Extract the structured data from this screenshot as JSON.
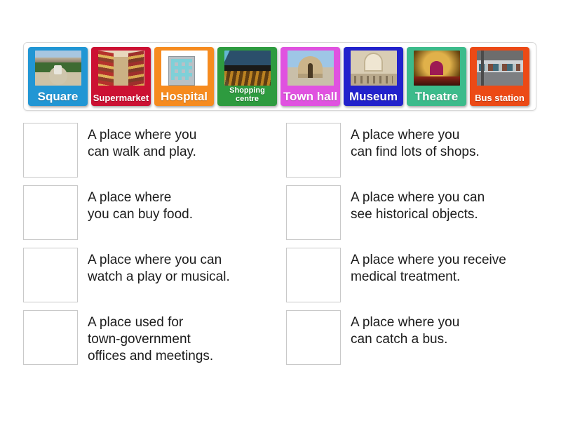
{
  "activity": {
    "type": "match-up",
    "tray_label": "Draggable word tiles"
  },
  "tiles": [
    {
      "label": "Square",
      "color": "#2196d4",
      "art": "art-square",
      "size": "size-lg"
    },
    {
      "label": "Supermarket",
      "color": "#cc1133",
      "art": "art-supermarket",
      "size": "size-md"
    },
    {
      "label": "Hospital",
      "color": "#f68b1f",
      "art": "art-hospital",
      "size": "size-lg"
    },
    {
      "label": "Shopping\ncentre",
      "color": "#2e9b3f",
      "art": "art-shopping",
      "size": "size-xs"
    },
    {
      "label": "Town hall",
      "color": "#e052e0",
      "art": "art-townhall",
      "size": "size-lg"
    },
    {
      "label": "Museum",
      "color": "#2222cc",
      "art": "art-museum",
      "size": "size-lg"
    },
    {
      "label": "Theatre",
      "color": "#3cbb8b",
      "art": "art-theatre",
      "size": "size-lg"
    },
    {
      "label": "Bus station",
      "color": "#ec4a16",
      "art": "art-busstation",
      "size": "size-md"
    }
  ],
  "answers": [
    {
      "text": "A place where you\ncan walk and play."
    },
    {
      "text": "A place where you\ncan find lots of shops."
    },
    {
      "text": "A place where\nyou can buy food."
    },
    {
      "text": "A place where you can\nsee historical objects."
    },
    {
      "text": "A place where you can\nwatch a play or musical."
    },
    {
      "text": "A place where you receive\nmedical treatment."
    },
    {
      "text": "A place used for\ntown-government\noffices and meetings."
    },
    {
      "text": "A place where you\ncan catch a bus."
    }
  ],
  "colors": {
    "page_background": "#ffffff",
    "tray_border": "#d8d8d8",
    "drop_zone_border": "#c9c9c9",
    "text": "#1c1c1c"
  }
}
